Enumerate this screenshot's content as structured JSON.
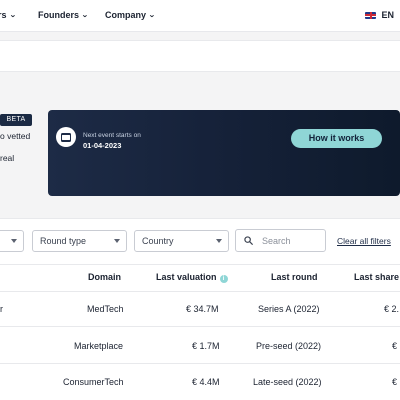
{
  "nav": {
    "items": [
      {
        "label": "rs"
      },
      {
        "label": "Founders"
      },
      {
        "label": "Company"
      }
    ],
    "language": "EN"
  },
  "hero": {
    "beta_badge": "BETA",
    "text_line1": "o vetted",
    "text_line2": "real",
    "event_label": "Next event starts on",
    "event_date": "01-04-2023",
    "how_button": "How it works"
  },
  "filters": {
    "select1_value": "",
    "round_type": "Round type",
    "country": "Country",
    "search_placeholder": "Search",
    "clear_all": "Clear all filters"
  },
  "table": {
    "headers": {
      "domain": "Domain",
      "last_valuation": "Last valuation",
      "last_round": "Last round",
      "last_share": "Last share"
    },
    "rows": [
      {
        "domain": "MedTech",
        "valuation": "€ 34.7M",
        "round": "Series A (2022)",
        "share": "€ 2.",
        "left_partial": "r"
      },
      {
        "domain": "Marketplace",
        "valuation": "€ 1.7M",
        "round": "Pre-seed (2022)",
        "share": "€",
        "left_partial": ""
      },
      {
        "domain": "ConsumerTech",
        "valuation": "€ 4.4M",
        "round": "Late-seed (2022)",
        "share": "€",
        "left_partial": ""
      }
    ]
  },
  "colors": {
    "banner": "#16223a",
    "accent": "#8fd6d6",
    "text": "#1b2230"
  }
}
